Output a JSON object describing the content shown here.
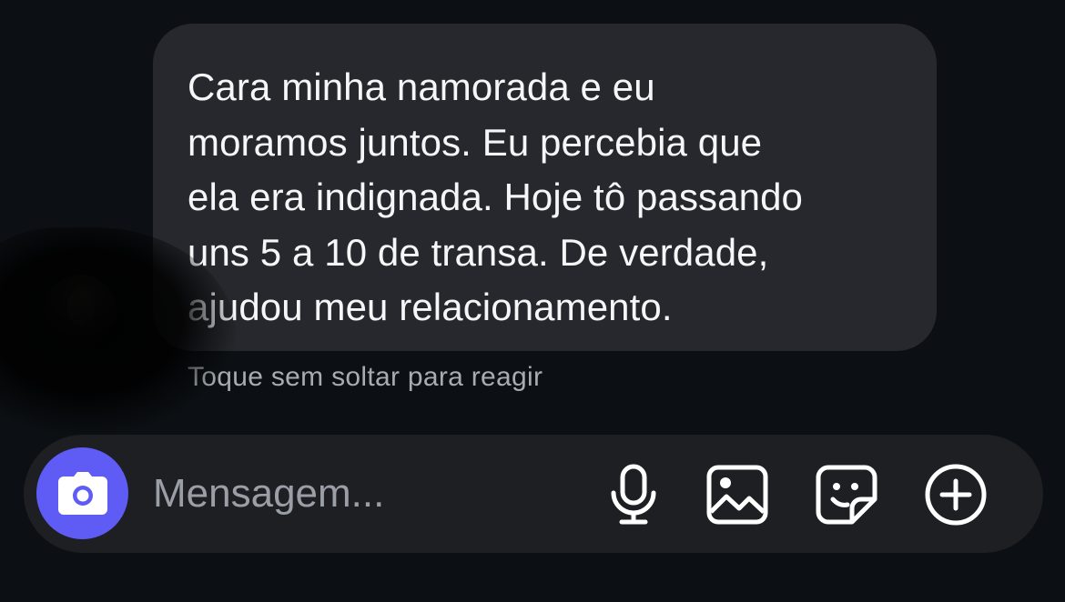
{
  "message": {
    "text": "Cara minha namorada e eu\nmoramos juntos. Eu percebia que\nela era indignada. Hoje tô passando\nuns 5 a 10 de transa. De verdade,\najudou meu relacionamento.",
    "hint": "Toque sem soltar para reagir"
  },
  "composer": {
    "placeholder": "Mensagem...",
    "icons": [
      "camera-icon",
      "microphone-icon",
      "image-icon",
      "sticker-icon",
      "plus-circle-icon"
    ],
    "camera_button_color": "#5e5cf4"
  },
  "colors": {
    "background": "#0c1014",
    "bubble": "#26282d",
    "composer": "#1d1f22"
  }
}
